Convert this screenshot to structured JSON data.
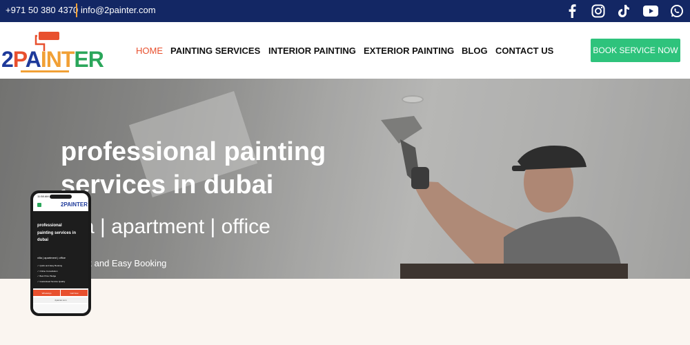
{
  "topbar": {
    "phone": "+971 50 380 4370",
    "email": "info@2painter.com",
    "social": [
      "facebook-icon",
      "instagram-icon",
      "tiktok-icon",
      "youtube-icon",
      "whatsapp-icon"
    ]
  },
  "brand": {
    "logo_text_parts": [
      "2",
      "P",
      "A",
      "INT",
      "E",
      "R"
    ]
  },
  "nav": {
    "items": [
      "HOME",
      "PAINTING SERVICES",
      "INTERIOR PAINTING",
      "EXTERIOR PAINTING",
      "BLOG",
      "CONTACT US"
    ],
    "active": "HOME",
    "cta": "BOOK SERVICE NOW"
  },
  "hero": {
    "title_line1": "professional painting",
    "title_line2": "services in dubai",
    "subtitle": "a | apartment | office",
    "feature": "ck and Easy Booking"
  },
  "phone_mockup": {
    "time": "11:58 AM",
    "logo": "2PAINTER",
    "title": "professional painting services in dubai",
    "subtitle": "villa | apartment | office",
    "features": [
      "Quick and Easy Booking",
      "Online Consultation",
      "Best Price Pledge",
      "Guaranteed Service Quality"
    ],
    "buttons": [
      "WhatsApp",
      "Call Now"
    ],
    "url": "2painter.com"
  },
  "colors": {
    "topbar_bg": "#132764",
    "accent_orange": "#e8502e",
    "cta_green": "#2ec37c",
    "brand_blue": "#1e3a9a",
    "brand_gold": "#f1a035"
  }
}
